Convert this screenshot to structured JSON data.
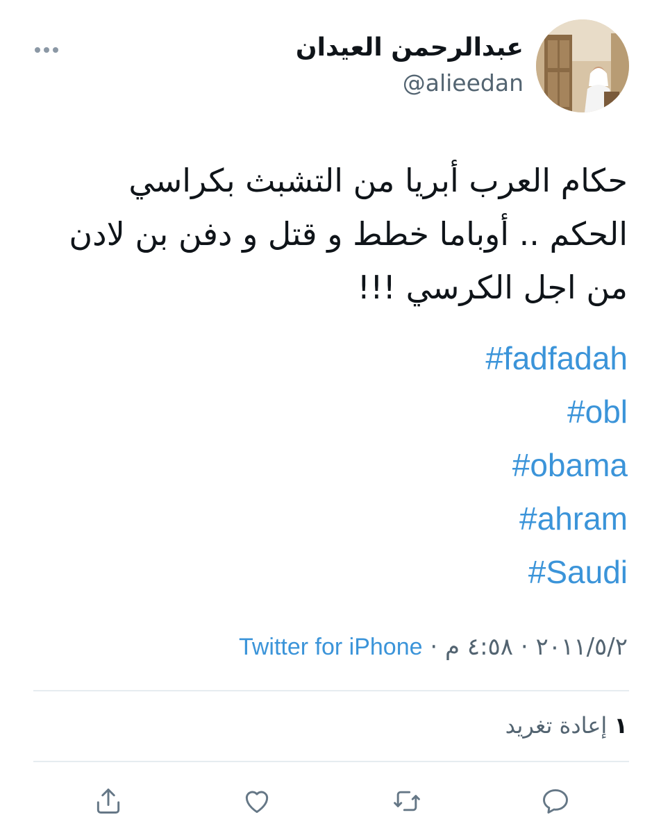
{
  "header": {
    "name": "عبدالرحمن العيدان",
    "handle": "@alieedan"
  },
  "tweet": {
    "text_lines": [
      "حكام العرب أبريا من التشبث بكراسي",
      "الحكم .. أوباما خطط و قتل و دفن بن لادن",
      "من اجل الكرسي !!!"
    ],
    "hashtags": [
      "#fadfadah",
      "#obl",
      "#obama",
      "#ahram",
      "#Saudi"
    ]
  },
  "meta": {
    "date": "٢٠١١/٥/٢",
    "time": "٤:٥٨ م",
    "separator": "·",
    "source": "Twitter for iPhone"
  },
  "stats": {
    "retweet_count": "١",
    "retweet_label": "إعادة تغريد"
  },
  "icons": {
    "more": "more-icon",
    "reply": "reply-icon",
    "retweet": "retweet-icon",
    "like": "like-icon",
    "share": "share-icon"
  },
  "colors": {
    "link": "#3b94d9",
    "secondary_text": "#536471",
    "icon": "#657786",
    "divider": "#e6ecf0"
  }
}
